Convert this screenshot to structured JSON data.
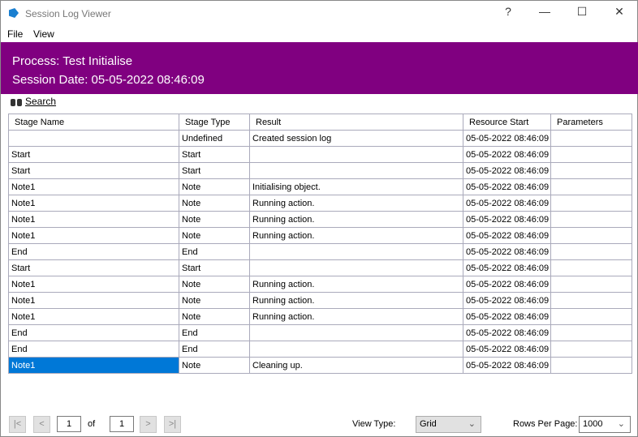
{
  "window": {
    "title": "Session Log Viewer",
    "help": "?",
    "minimize": "—",
    "maximize": "☐",
    "close": "✕"
  },
  "menu": [
    "File",
    "View"
  ],
  "banner": {
    "process": "Process: Test Initialise",
    "session_date": "Session Date: 05-05-2022 08:46:09",
    "color": "#800080"
  },
  "search_label": "Search",
  "table": {
    "headers": [
      "Stage Name",
      "Stage Type",
      "Result",
      "Resource Start",
      "Parameters"
    ],
    "rows": [
      [
        "",
        "Undefined",
        "Created session log",
        "05-05-2022 08:46:09",
        ""
      ],
      [
        "Start",
        "Start",
        "",
        "05-05-2022 08:46:09",
        ""
      ],
      [
        "Start",
        "Start",
        "",
        "05-05-2022 08:46:09",
        ""
      ],
      [
        "Note1",
        "Note",
        "Initialising object.",
        "05-05-2022 08:46:09",
        ""
      ],
      [
        "Note1",
        "Note",
        "Running action.",
        "05-05-2022 08:46:09",
        ""
      ],
      [
        "Note1",
        "Note",
        "Running action.",
        "05-05-2022 08:46:09",
        ""
      ],
      [
        "Note1",
        "Note",
        "Running action.",
        "05-05-2022 08:46:09",
        ""
      ],
      [
        "End",
        "End",
        "",
        "05-05-2022 08:46:09",
        ""
      ],
      [
        "Start",
        "Start",
        "",
        "05-05-2022 08:46:09",
        ""
      ],
      [
        "Note1",
        "Note",
        "Running action.",
        "05-05-2022 08:46:09",
        ""
      ],
      [
        "Note1",
        "Note",
        "Running action.",
        "05-05-2022 08:46:09",
        ""
      ],
      [
        "Note1",
        "Note",
        "Running action.",
        "05-05-2022 08:46:09",
        ""
      ],
      [
        "End",
        "End",
        "",
        "05-05-2022 08:46:09",
        ""
      ],
      [
        "End",
        "End",
        "",
        "05-05-2022 08:46:09",
        ""
      ],
      [
        "Note1",
        "Note",
        "Cleaning up.",
        "05-05-2022 08:46:09",
        ""
      ]
    ],
    "selected_row": 14
  },
  "footer": {
    "first": "|<",
    "prev": "<",
    "page": "1",
    "of": "of",
    "total": "1",
    "next": ">",
    "last": ">|",
    "view_type_label": "View Type:",
    "view_type": "Grid",
    "rows_per_page_label": "Rows Per Page:",
    "rows_per_page": "1000"
  }
}
